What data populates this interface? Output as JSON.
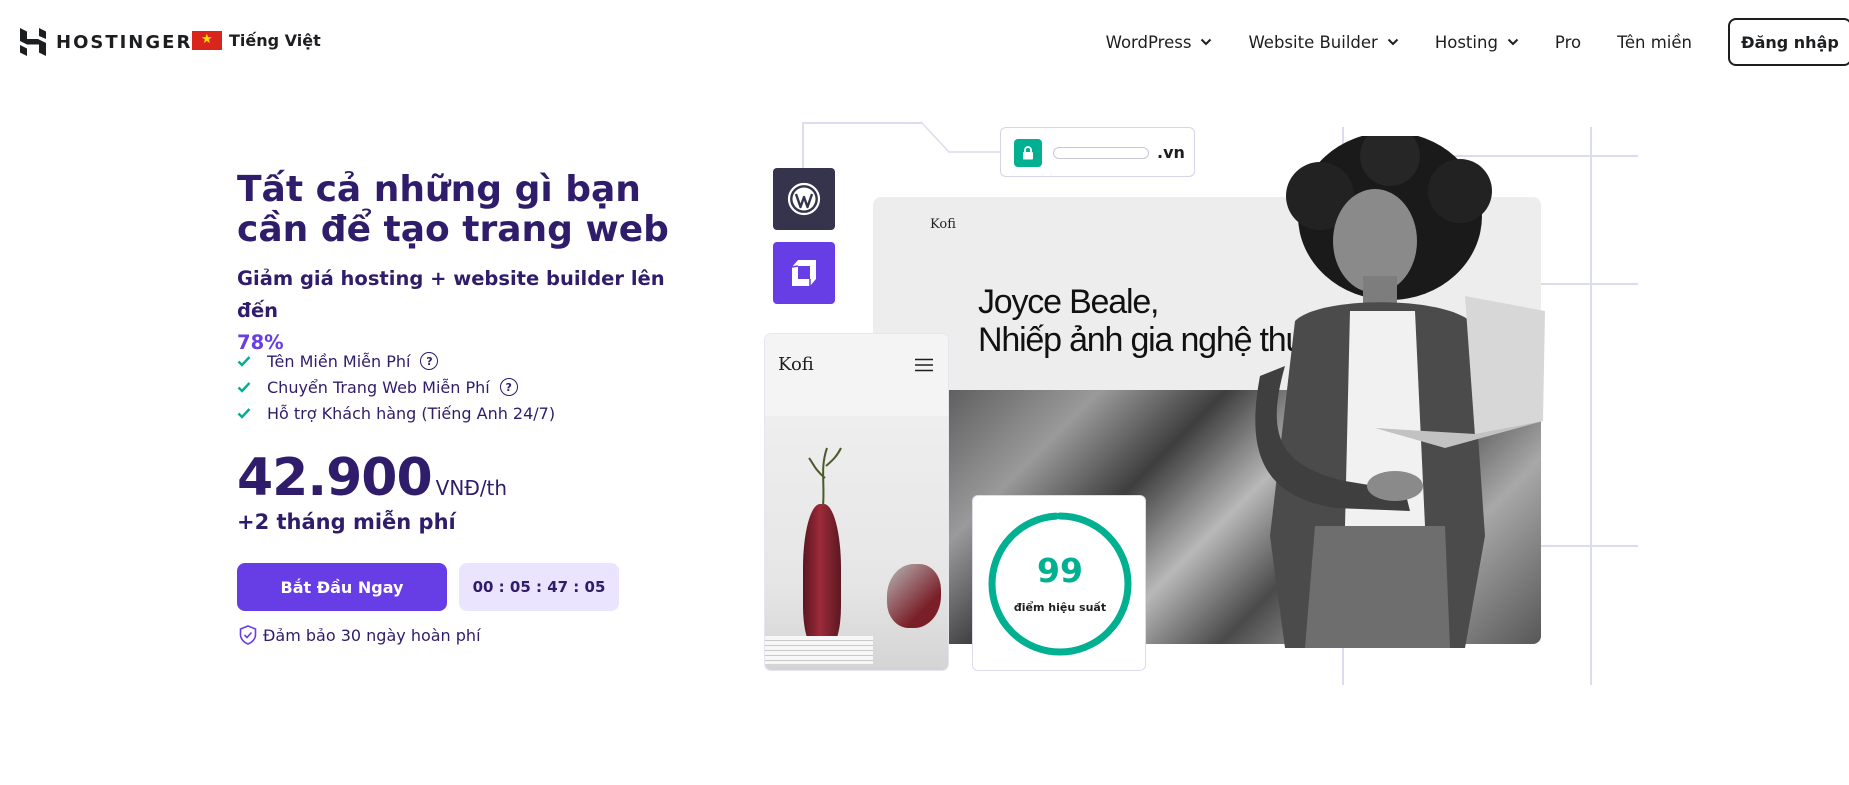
{
  "header": {
    "logo_text": "HOSTINGER",
    "language": "Tiếng Việt",
    "nav": [
      {
        "label": "WordPress",
        "has_dropdown": true
      },
      {
        "label": "Website Builder",
        "has_dropdown": true
      },
      {
        "label": "Hosting",
        "has_dropdown": true
      },
      {
        "label": "Pro",
        "has_dropdown": false
      },
      {
        "label": "Tên miền",
        "has_dropdown": false
      }
    ],
    "login_label": "Đăng nhập"
  },
  "hero": {
    "title": "Tất cả những gì bạn cần để tạo trang web",
    "subtitle": "Giảm giá hosting + website builder lên đến",
    "discount": "78%",
    "features": [
      {
        "label": "Tên Miền Miễn Phí",
        "help": true
      },
      {
        "label": "Chuyển Trang Web Miễn Phí",
        "help": true
      },
      {
        "label": "Hỗ trợ Khách hàng (Tiếng Anh 24/7)",
        "help": false
      }
    ],
    "help_glyph": "?",
    "price": "42.900",
    "price_unit": "VNĐ/th",
    "bonus": "+2 tháng miễn phí",
    "cta_label": "Bắt Đầu Ngay",
    "timer": "00 : 05 : 47 : 05",
    "guarantee": "Đảm bảo 30 ngày hoàn phí"
  },
  "illustration": {
    "domain_tld": ".vn",
    "site_brand": "Kofi",
    "site_heading": "Joyce Beale,\nNhiếp ảnh gia nghệ thu",
    "mobile_brand": "Kofi",
    "score": "99",
    "score_label": "điểm hiệu suất",
    "score_fraction": 0.99
  },
  "colors": {
    "brand_purple": "#673de6",
    "heading_navy": "#2f1c6a",
    "accent_green": "#00b090",
    "timer_bg": "#ebe4ff"
  },
  "icons": [
    "hostinger-logo-icon",
    "vietnam-flag-icon",
    "chevron-down-icon",
    "check-icon",
    "help-circle-icon",
    "shield-check-icon",
    "lock-icon",
    "wordpress-icon",
    "hostinger-builder-icon",
    "menu-icon"
  ]
}
